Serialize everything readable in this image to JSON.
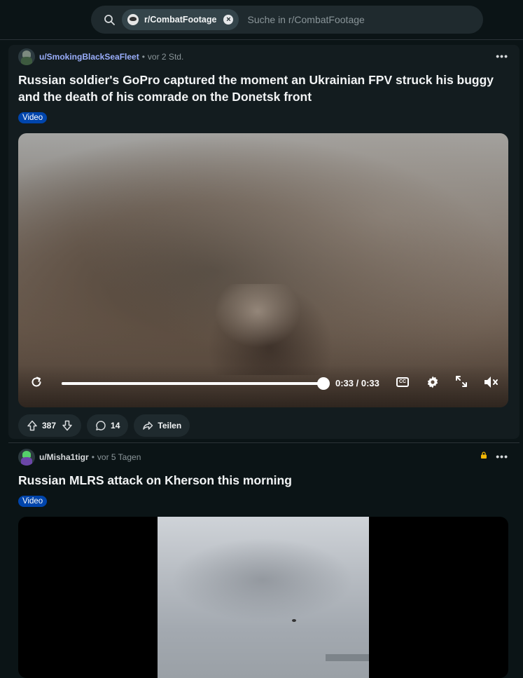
{
  "search": {
    "subreddit_chip": "r/CombatFootage",
    "placeholder": "Suche in r/CombatFootage"
  },
  "posts": [
    {
      "user": "u/SmokingBlackSeaFleet",
      "time": "vor 2 Std.",
      "title": "Russian soldier's GoPro captured the moment an Ukrainian FPV struck his buggy and the death of his comrade on the Donetsk front",
      "flair": "Video",
      "video": {
        "timecode": "0:33 / 0:33",
        "progress": 1.0,
        "cc_label": "CC"
      },
      "actions": {
        "votes": "387",
        "comments": "14",
        "share": "Teilen"
      }
    },
    {
      "user": "u/Misha1tigr",
      "time": "vor 5 Tagen",
      "title": "Russian MLRS attack on Kherson this morning",
      "flair": "Video"
    }
  ],
  "colors": {
    "background": "#0b1416",
    "card": "#131c1f",
    "username": "#9aaefc",
    "flair": "#0045ac",
    "lock": "#f2b705"
  }
}
